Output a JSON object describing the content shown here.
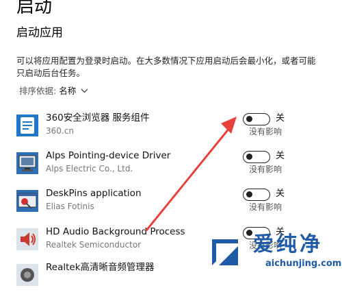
{
  "header": {
    "title": "启动"
  },
  "section": {
    "title": "启动应用",
    "description": "可以将应用配置为登录时启动。在大多数情况下应用启动后会最小化，或者可能只启动后台任务。",
    "sort_label": "排序依据:",
    "sort_value": "名称",
    "sort_icon": "chevron-down-icon"
  },
  "apps": [
    {
      "name": "360安全浏览器 服务组件",
      "publisher": "360.cn",
      "state": "关",
      "impact": "没有影响",
      "icon": "app-360-icon"
    },
    {
      "name": "Alps Pointing-device Driver",
      "publisher": "Alps Electric Co., Ltd.",
      "state": "关",
      "impact": "没有影响",
      "icon": "monitor-icon"
    },
    {
      "name": "DeskPins application",
      "publisher": "Elias Fotinis",
      "state": "关",
      "impact": "没有影响",
      "icon": "pin-icon"
    },
    {
      "name": "HD Audio Background Process",
      "publisher": "Realtek Semiconductor",
      "state": "关",
      "impact": "没有影响",
      "icon": "speaker-icon"
    },
    {
      "name": "Realtek高清晰音频管理器",
      "publisher": "",
      "state": "",
      "impact": "",
      "icon": "speaker-icon"
    }
  ],
  "watermark": {
    "name": "爱纯净",
    "url": "aichunjing.com"
  },
  "colors": {
    "arrow": "#e8413c",
    "toggle": "#222222",
    "watermark": "#1f5aa6"
  }
}
